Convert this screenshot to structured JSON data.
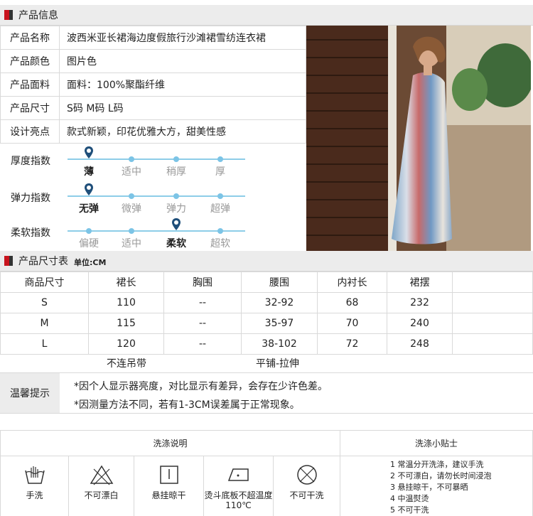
{
  "product_info": {
    "title": "产品信息",
    "rows": [
      {
        "label": "产品名称",
        "value": "波西米亚长裙海边度假旅行沙滩裙雪纺连衣裙"
      },
      {
        "label": "产品颜色",
        "value": "图片色"
      },
      {
        "label": "产品面料",
        "value": "面料：100%聚酯纤维"
      },
      {
        "label": "产品尺寸",
        "value": "S码 M码 L码"
      },
      {
        "label": "设计亮点",
        "value": "款式新颖，印花优雅大方，甜美性感"
      }
    ],
    "indices": [
      {
        "label": "厚度指数",
        "options": [
          "薄",
          "适中",
          "稍厚",
          "厚"
        ],
        "selected": 0
      },
      {
        "label": "弹力指数",
        "options": [
          "无弹",
          "微弹",
          "弹力",
          "超弹"
        ],
        "selected": 0
      },
      {
        "label": "柔软指数",
        "options": [
          "偏硬",
          "适中",
          "柔软",
          "超软"
        ],
        "selected": 2
      }
    ]
  },
  "size_chart": {
    "title": "产品尺寸表",
    "unit": "单位:CM",
    "headers": [
      "商品尺寸",
      "裙长",
      "胸围",
      "腰围",
      "内衬长",
      "裙摆"
    ],
    "rows": [
      [
        "S",
        "110",
        "--",
        "32-92",
        "68",
        "232"
      ],
      [
        "M",
        "115",
        "--",
        "35-97",
        "70",
        "240"
      ],
      [
        "L",
        "120",
        "--",
        "38-102",
        "72",
        "248"
      ]
    ],
    "note_left": "不连吊带",
    "note_right": "平铺-拉伸"
  },
  "tips": {
    "label": "温馨提示",
    "lines": [
      "*因个人显示器亮度，对比显示有差异，会存在少许色差。",
      "*因测量方法不同，若有1-3CM误差属于正常现象。"
    ]
  },
  "wash": {
    "header": "洗涤说明",
    "tips_header": "洗涤小贴士",
    "items": [
      {
        "icon": "hand-wash-icon",
        "label": "手洗"
      },
      {
        "icon": "no-bleach-icon",
        "label": "不可漂白"
      },
      {
        "icon": "hang-dry-icon",
        "label": "悬挂晾干"
      },
      {
        "icon": "iron-icon",
        "label": "烫斗底板不超温度110℃"
      },
      {
        "icon": "no-tumble-dry-icon",
        "label": "不可干洗"
      }
    ],
    "tips": [
      "1 常温分开洗涤，建议手洗",
      "2 不可漂白，请勿长时间浸泡",
      "3 悬挂晾干，不可暴晒",
      "4 中温熨烫",
      "5 不可干洗"
    ]
  },
  "colors": {
    "accent_red": "#c8141e",
    "index_blue": "#8dcde8",
    "pin_navy": "#1f4f7a"
  }
}
